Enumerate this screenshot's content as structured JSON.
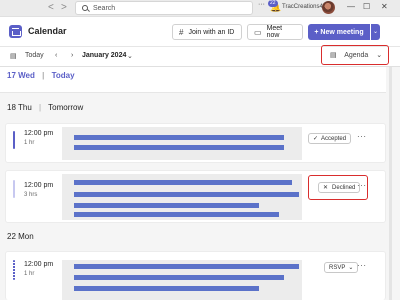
{
  "titlebar": {
    "back": "<",
    "forward": ">",
    "search_placeholder": "Search",
    "more": "···",
    "notification_count": "22",
    "org_name": "TracCreations48",
    "minimize": "—",
    "maximize": "☐",
    "close": "✕"
  },
  "header": {
    "title": "Calendar",
    "join_label": "Join with an ID",
    "meet_label": "Meet now",
    "new_label": "+ New meeting"
  },
  "toolbar": {
    "today_label": "Today",
    "month_label": "January 2024",
    "view_label": "Agenda"
  },
  "agenda": {
    "day1": {
      "date": "17 Wed",
      "relative": "Today"
    },
    "day2": {
      "date": "18 Thu",
      "relative": "Tomorrow"
    },
    "day3": {
      "date": "22 Mon"
    },
    "events": [
      {
        "time": "12:00 pm",
        "duration": "1 hr",
        "status": "Accepted",
        "status_icon": "check-icon"
      },
      {
        "time": "12:00 pm",
        "duration": "3 hrs",
        "status": "Declined",
        "status_icon": "x-icon"
      },
      {
        "time": "12:00 pm",
        "duration": "1 hr",
        "status": "RSVP",
        "status_icon": "chevron-down-icon"
      }
    ]
  },
  "colors": {
    "accent": "#5b5fc7",
    "bar_placeholder": "#5b72c9",
    "highlight": "#d92d2d",
    "declined_bar": "#c7c8f0"
  }
}
